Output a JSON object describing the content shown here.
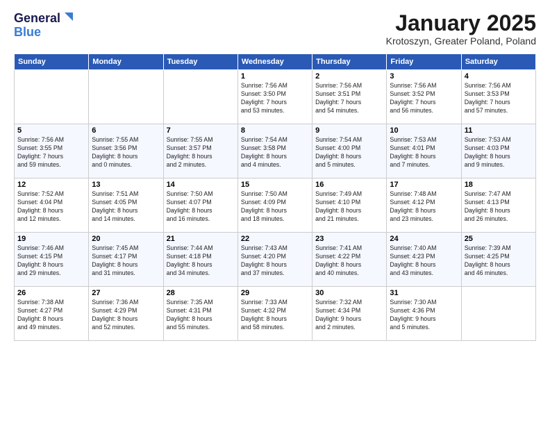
{
  "logo": {
    "general": "General",
    "blue": "Blue"
  },
  "title": "January 2025",
  "subtitle": "Krotoszyn, Greater Poland, Poland",
  "days_of_week": [
    "Sunday",
    "Monday",
    "Tuesday",
    "Wednesday",
    "Thursday",
    "Friday",
    "Saturday"
  ],
  "weeks": [
    [
      {
        "day": "",
        "info": ""
      },
      {
        "day": "",
        "info": ""
      },
      {
        "day": "",
        "info": ""
      },
      {
        "day": "1",
        "info": "Sunrise: 7:56 AM\nSunset: 3:50 PM\nDaylight: 7 hours\nand 53 minutes."
      },
      {
        "day": "2",
        "info": "Sunrise: 7:56 AM\nSunset: 3:51 PM\nDaylight: 7 hours\nand 54 minutes."
      },
      {
        "day": "3",
        "info": "Sunrise: 7:56 AM\nSunset: 3:52 PM\nDaylight: 7 hours\nand 56 minutes."
      },
      {
        "day": "4",
        "info": "Sunrise: 7:56 AM\nSunset: 3:53 PM\nDaylight: 7 hours\nand 57 minutes."
      }
    ],
    [
      {
        "day": "5",
        "info": "Sunrise: 7:56 AM\nSunset: 3:55 PM\nDaylight: 7 hours\nand 59 minutes."
      },
      {
        "day": "6",
        "info": "Sunrise: 7:55 AM\nSunset: 3:56 PM\nDaylight: 8 hours\nand 0 minutes."
      },
      {
        "day": "7",
        "info": "Sunrise: 7:55 AM\nSunset: 3:57 PM\nDaylight: 8 hours\nand 2 minutes."
      },
      {
        "day": "8",
        "info": "Sunrise: 7:54 AM\nSunset: 3:58 PM\nDaylight: 8 hours\nand 4 minutes."
      },
      {
        "day": "9",
        "info": "Sunrise: 7:54 AM\nSunset: 4:00 PM\nDaylight: 8 hours\nand 5 minutes."
      },
      {
        "day": "10",
        "info": "Sunrise: 7:53 AM\nSunset: 4:01 PM\nDaylight: 8 hours\nand 7 minutes."
      },
      {
        "day": "11",
        "info": "Sunrise: 7:53 AM\nSunset: 4:03 PM\nDaylight: 8 hours\nand 9 minutes."
      }
    ],
    [
      {
        "day": "12",
        "info": "Sunrise: 7:52 AM\nSunset: 4:04 PM\nDaylight: 8 hours\nand 12 minutes."
      },
      {
        "day": "13",
        "info": "Sunrise: 7:51 AM\nSunset: 4:05 PM\nDaylight: 8 hours\nand 14 minutes."
      },
      {
        "day": "14",
        "info": "Sunrise: 7:50 AM\nSunset: 4:07 PM\nDaylight: 8 hours\nand 16 minutes."
      },
      {
        "day": "15",
        "info": "Sunrise: 7:50 AM\nSunset: 4:09 PM\nDaylight: 8 hours\nand 18 minutes."
      },
      {
        "day": "16",
        "info": "Sunrise: 7:49 AM\nSunset: 4:10 PM\nDaylight: 8 hours\nand 21 minutes."
      },
      {
        "day": "17",
        "info": "Sunrise: 7:48 AM\nSunset: 4:12 PM\nDaylight: 8 hours\nand 23 minutes."
      },
      {
        "day": "18",
        "info": "Sunrise: 7:47 AM\nSunset: 4:13 PM\nDaylight: 8 hours\nand 26 minutes."
      }
    ],
    [
      {
        "day": "19",
        "info": "Sunrise: 7:46 AM\nSunset: 4:15 PM\nDaylight: 8 hours\nand 29 minutes."
      },
      {
        "day": "20",
        "info": "Sunrise: 7:45 AM\nSunset: 4:17 PM\nDaylight: 8 hours\nand 31 minutes."
      },
      {
        "day": "21",
        "info": "Sunrise: 7:44 AM\nSunset: 4:18 PM\nDaylight: 8 hours\nand 34 minutes."
      },
      {
        "day": "22",
        "info": "Sunrise: 7:43 AM\nSunset: 4:20 PM\nDaylight: 8 hours\nand 37 minutes."
      },
      {
        "day": "23",
        "info": "Sunrise: 7:41 AM\nSunset: 4:22 PM\nDaylight: 8 hours\nand 40 minutes."
      },
      {
        "day": "24",
        "info": "Sunrise: 7:40 AM\nSunset: 4:23 PM\nDaylight: 8 hours\nand 43 minutes."
      },
      {
        "day": "25",
        "info": "Sunrise: 7:39 AM\nSunset: 4:25 PM\nDaylight: 8 hours\nand 46 minutes."
      }
    ],
    [
      {
        "day": "26",
        "info": "Sunrise: 7:38 AM\nSunset: 4:27 PM\nDaylight: 8 hours\nand 49 minutes."
      },
      {
        "day": "27",
        "info": "Sunrise: 7:36 AM\nSunset: 4:29 PM\nDaylight: 8 hours\nand 52 minutes."
      },
      {
        "day": "28",
        "info": "Sunrise: 7:35 AM\nSunset: 4:31 PM\nDaylight: 8 hours\nand 55 minutes."
      },
      {
        "day": "29",
        "info": "Sunrise: 7:33 AM\nSunset: 4:32 PM\nDaylight: 8 hours\nand 58 minutes."
      },
      {
        "day": "30",
        "info": "Sunrise: 7:32 AM\nSunset: 4:34 PM\nDaylight: 9 hours\nand 2 minutes."
      },
      {
        "day": "31",
        "info": "Sunrise: 7:30 AM\nSunset: 4:36 PM\nDaylight: 9 hours\nand 5 minutes."
      },
      {
        "day": "",
        "info": ""
      }
    ]
  ]
}
